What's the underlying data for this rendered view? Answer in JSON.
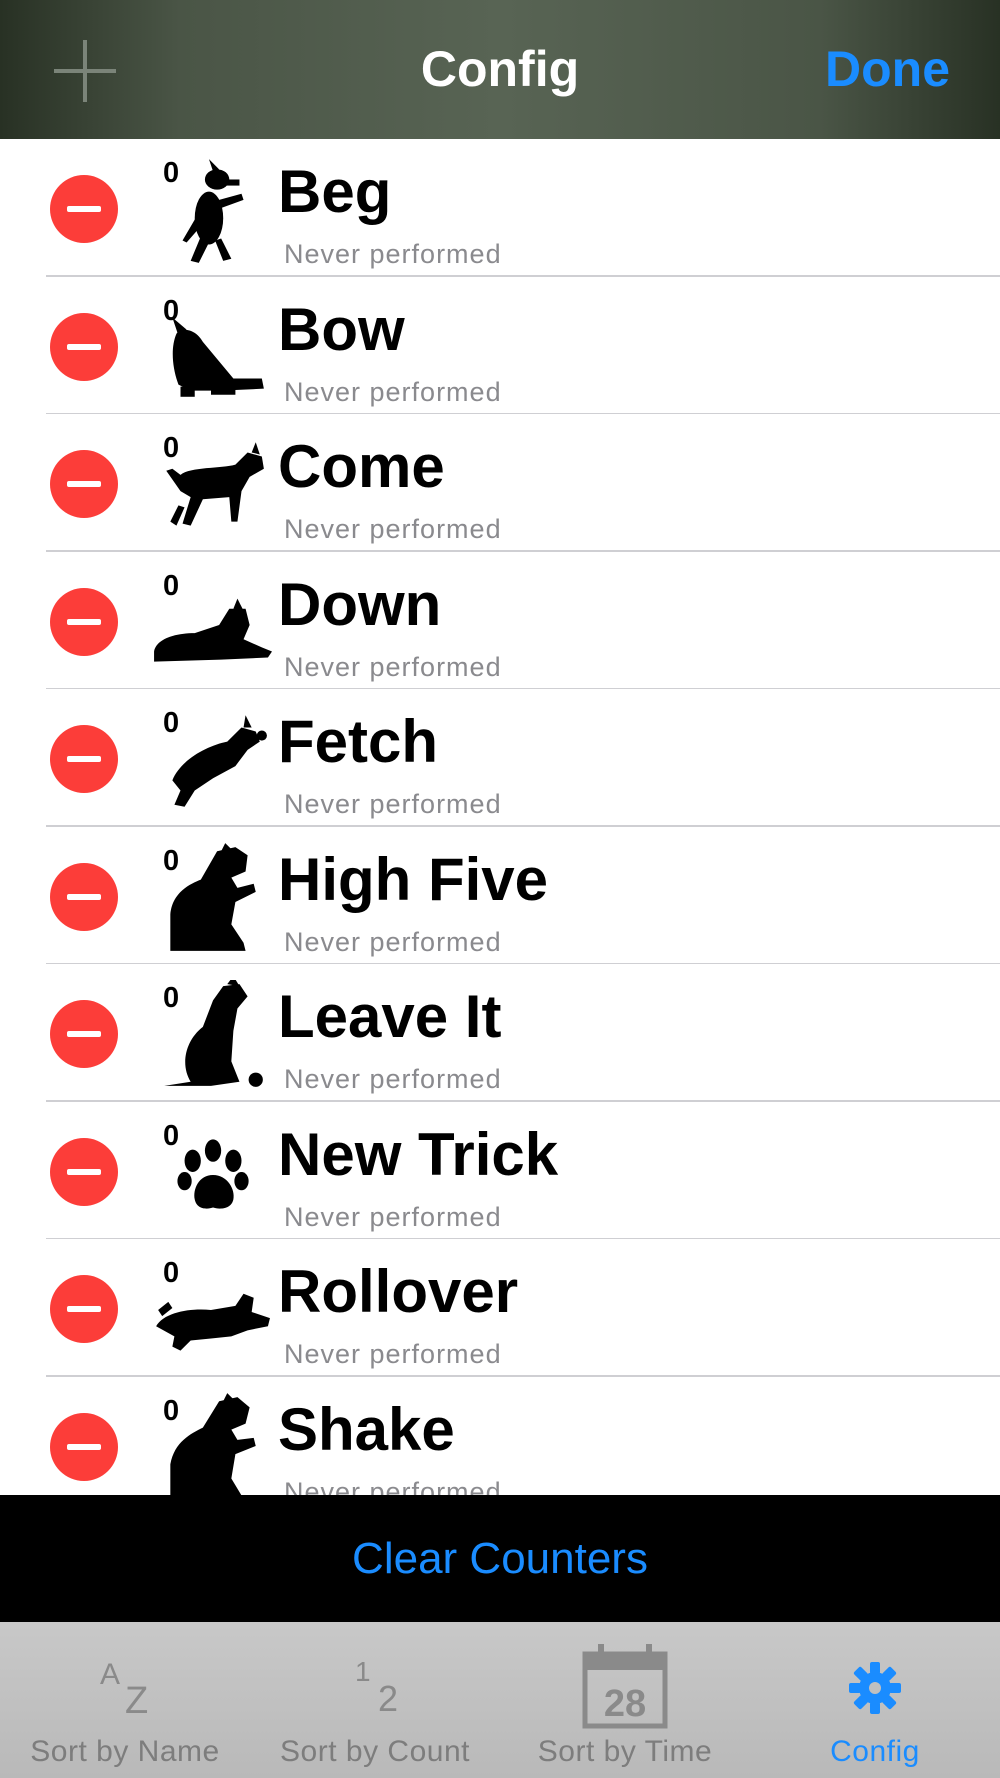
{
  "nav": {
    "title": "Config",
    "done_label": "Done",
    "add_icon": "plus-icon"
  },
  "tricks": [
    {
      "name": "Beg",
      "count": "0",
      "status": "Never performed",
      "icon": "dog-begging-icon"
    },
    {
      "name": "Bow",
      "count": "0",
      "status": "Never performed",
      "icon": "dog-bowing-icon"
    },
    {
      "name": "Come",
      "count": "0",
      "status": "Never performed",
      "icon": "dog-walking-icon"
    },
    {
      "name": "Down",
      "count": "0",
      "status": "Never performed",
      "icon": "dog-lying-down-icon"
    },
    {
      "name": "Fetch",
      "count": "0",
      "status": "Never performed",
      "icon": "dog-jumping-icon"
    },
    {
      "name": "High Five",
      "count": "0",
      "status": "Never performed",
      "icon": "dog-high-five-icon"
    },
    {
      "name": "Leave It",
      "count": "0",
      "status": "Never performed",
      "icon": "dog-sitting-with-ball-icon"
    },
    {
      "name": "New Trick",
      "count": "0",
      "status": "Never performed",
      "icon": "paw-print-icon"
    },
    {
      "name": "Rollover",
      "count": "0",
      "status": "Never performed",
      "icon": "dog-rolling-over-icon"
    },
    {
      "name": "Shake",
      "count": "0",
      "status": "Never performed",
      "icon": "dog-shaking-paw-icon"
    }
  ],
  "clear_label": "Clear Counters",
  "tabs": [
    {
      "label": "Sort by Name",
      "icon": "alphabetical-sort-icon",
      "glyph_a": "A",
      "glyph_b": "Z"
    },
    {
      "label": "Sort by Count",
      "icon": "numeric-sort-icon",
      "glyph_a": "1",
      "glyph_b": "2"
    },
    {
      "label": "Sort by Time",
      "icon": "calendar-icon",
      "calendar_day": "28"
    },
    {
      "label": "Config",
      "icon": "gear-icon",
      "active": true
    }
  ],
  "colors": {
    "accent": "#1a8cff",
    "delete": "#fc3d39",
    "nav_background": "#4a5546",
    "subtitle": "#8a8a8e",
    "tabbar_background": "#c0c0c0"
  }
}
